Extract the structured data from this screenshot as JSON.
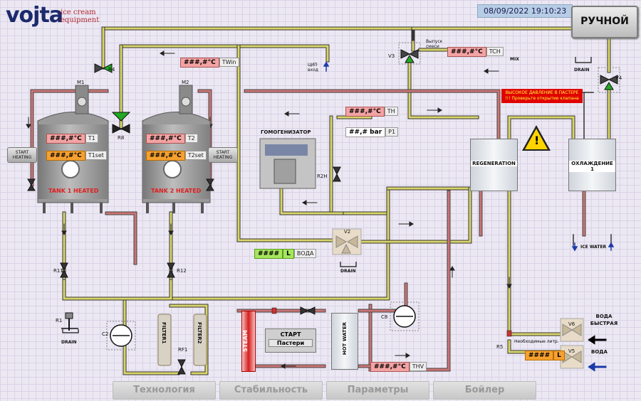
{
  "logo": {
    "main": "vojta",
    "line1": "ice cream",
    "line2": "equipment"
  },
  "datetime": "08/09/2022 19:10:23",
  "mode_button": "РУЧНОЙ",
  "pipe_colors": {
    "yellow": "#d9d56a",
    "red": "#cc7474",
    "outline": "#333333"
  },
  "temps": {
    "twin": {
      "value": "###,#°C",
      "label": "TWin"
    },
    "tch": {
      "value": "###,#°C",
      "label": "TCH"
    },
    "th": {
      "value": "###,#°C",
      "label": "TH"
    },
    "p1": {
      "value": "##,# bar",
      "label": "P1"
    },
    "t1": {
      "value": "###,#°C",
      "label": "T1"
    },
    "t1set": {
      "value": "###,#°C",
      "label": "T1set"
    },
    "t2": {
      "value": "###,#°C",
      "label": "T2"
    },
    "t2set": {
      "value": "###,#°C",
      "label": "T2set"
    },
    "voda": {
      "value": "####",
      "unit": "L",
      "label": "ВОДА"
    },
    "thv": {
      "value": "###,#°C",
      "label": "THV"
    },
    "v5_volume": {
      "value": "####",
      "unit": "L"
    }
  },
  "labels": {
    "vypusk": "Выпуск смеси",
    "mix": "MIX",
    "cip": "ЦИП вход",
    "drain": "DRAIN",
    "homogenizer": "ГОМОГЕНИЗАТОР",
    "regeneration": "REGENERATION",
    "cooling": "ОХЛАЖДЕНИЕ 1",
    "ice_water": "ICE WATER",
    "voda_fast": "ВОДА БЫСТРАЯ",
    "voda": "ВОДА",
    "needed_liters": "Необходимые литр.",
    "steam": "STEAM",
    "hot_water": "HOT WATER",
    "start_pasteur_1": "СТАРТ",
    "start_pasteur_2": "Пастери",
    "tank1": "TANK 1 HEATED",
    "tank2": "TANK 2 HEATED",
    "start_heating": "START HEATING",
    "alarm": "ВЫСОКОЕ ДАВЛЕНИЕ В ПАСТЕРЕ !!! Проверьте открытие клапана"
  },
  "devices": {
    "m1": "M1",
    "m2": "M2",
    "r4": "R4",
    "r8": "R8",
    "r11": "R11",
    "r12": "R12",
    "r1": "R1",
    "rf1": "RF1",
    "r2h": "R2H",
    "r5": "R5",
    "v2": "V2",
    "v3": "V3",
    "v4": "V4",
    "v5": "V5",
    "v6": "V6",
    "c2": "C2",
    "c8": "C8",
    "filter1": "FILTER1",
    "filter2": "FILTER2"
  },
  "nav": [
    "Технология",
    "Стабильность",
    "Параметры",
    "Бойлер"
  ]
}
